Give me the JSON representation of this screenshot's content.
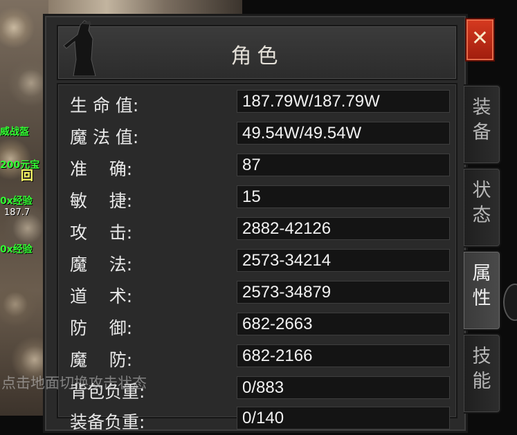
{
  "world": {
    "floating_texts": [
      {
        "text": "威战盔",
        "color": "#33ff33"
      },
      {
        "text": "200元宝",
        "color": "#33ff33"
      },
      {
        "text": "回",
        "color": "#ffff66"
      },
      {
        "text": "0x经验",
        "color": "#33ff33"
      },
      {
        "text": "187.7",
        "color": "#ffffff"
      },
      {
        "text": "0x经验",
        "color": "#33ff33"
      }
    ],
    "hint_text": "点击地面切换攻击状态"
  },
  "panel": {
    "title": "角色",
    "close_symbol": "✕",
    "tabs": [
      {
        "label": "装备"
      },
      {
        "label": "状态"
      },
      {
        "label": "属性",
        "active": true
      },
      {
        "label": "技能"
      }
    ],
    "stats": [
      {
        "label": "生 命 值:",
        "value": "187.79W/187.79W"
      },
      {
        "label": "魔 法 值:",
        "value": "49.54W/49.54W"
      },
      {
        "label": "准    确:",
        "value": "87"
      },
      {
        "label": "敏    捷:",
        "value": "15"
      },
      {
        "label": "攻    击:",
        "value": "2882-42126"
      },
      {
        "label": "魔    法:",
        "value": "2573-34214"
      },
      {
        "label": "道    术:",
        "value": "2573-34879"
      },
      {
        "label": "防    御:",
        "value": "682-2663"
      },
      {
        "label": "魔    防:",
        "value": "682-2166"
      },
      {
        "label": "背包负重:",
        "value": "0/883"
      },
      {
        "label": "装备负重:",
        "value": "0/140"
      }
    ]
  },
  "colors": {
    "close_red": "#c42c15",
    "panel_bg": "#2a2a2a",
    "value_bg": "#141414"
  }
}
